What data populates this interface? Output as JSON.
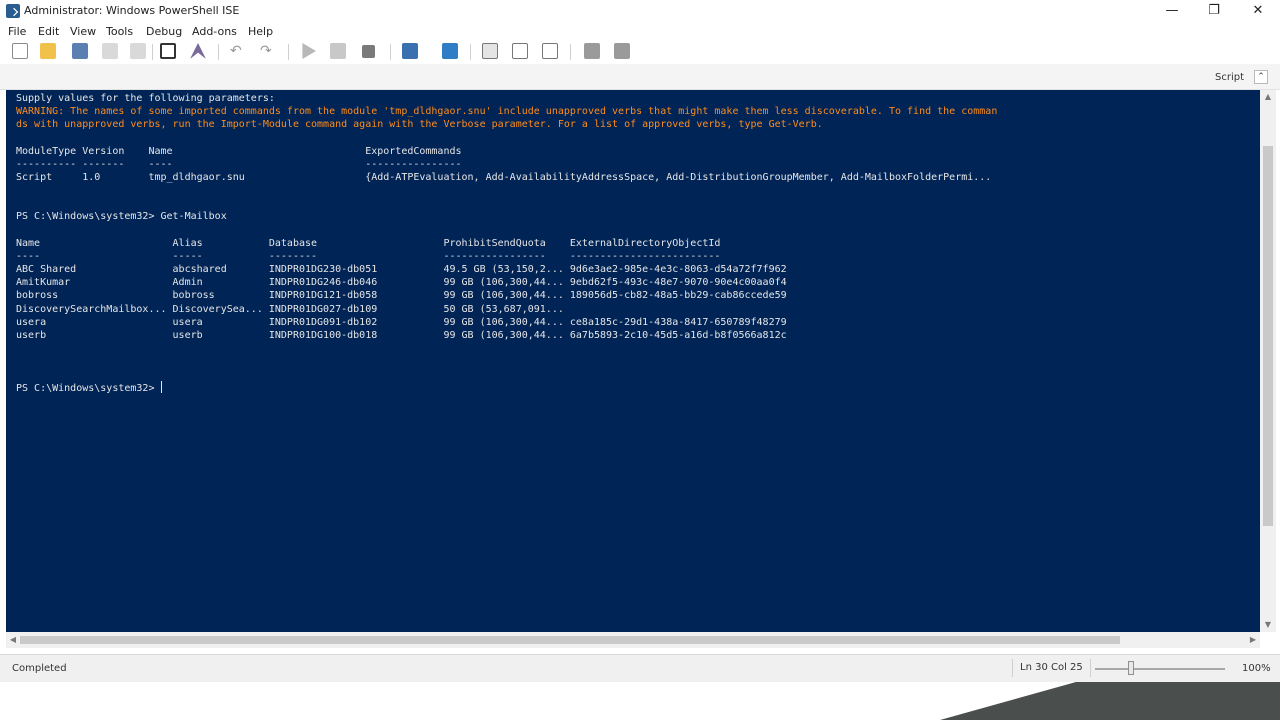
{
  "window": {
    "title": "Administrator: Windows PowerShell ISE",
    "min_glyph": "—",
    "max_glyph": "❐",
    "close_glyph": "✕"
  },
  "menu": {
    "items": [
      "File",
      "Edit",
      "View",
      "Tools",
      "Debug",
      "Add-ons",
      "Help"
    ]
  },
  "toolbar": {
    "icons": [
      "new-icon",
      "open-icon",
      "save-icon",
      "cut-icon",
      "copy-icon",
      "paste-icon",
      "clear-icon",
      "undo-icon",
      "redo-icon",
      "run-icon",
      "run-selection-icon",
      "stop-icon",
      "new-remote-tab-icon",
      "start-powershell-icon",
      "show-script-pane-top-icon",
      "show-script-pane-right-icon",
      "show-script-pane-max-icon",
      "show-command-window-icon",
      "show-command-addon-icon"
    ]
  },
  "script_bar": {
    "label": "Script",
    "chevron": "⌃"
  },
  "console": {
    "prompt_line_params": "Supply values for the following parameters:",
    "warning": "WARNING: The names of some imported commands from the module 'tmp_dldhgaor.snu' include unapproved verbs that might make them less discoverable. To find the comman\nds with unapproved verbs, run the Import-Module command again with the Verbose parameter. For a list of approved verbs, type Get-Verb.",
    "module_table": "ModuleType Version    Name                                ExportedCommands\n---------- -------    ----                                ----------------\nScript     1.0        tmp_dldhgaor.snu                    {Add-ATPEvaluation, Add-AvailabilityAddressSpace, Add-DistributionGroupMember, Add-MailboxFolderPermi...",
    "command_line": "PS C:\\Windows\\system32> Get-Mailbox",
    "mailbox_table": "Name                      Alias           Database                     ProhibitSendQuota    ExternalDirectoryObjectId\n----                      -----           --------                     -----------------    -------------------------\nABC Shared                abcshared       INDPR01DG230-db051           49.5 GB (53,150,2... 9d6e3ae2-985e-4e3c-8063-d54a72f7f962\nAmitKumar                 Admin           INDPR01DG246-db046           99 GB (106,300,44... 9ebd62f5-493c-48e7-9070-90e4c00aa0f4\nbobross                   bobross         INDPR01DG121-db058           99 GB (106,300,44... 189056d5-cb82-48a5-bb29-cab86ccede59\nDiscoverySearchMailbox... DiscoverySea... INDPR01DG027-db109           50 GB (53,687,091...\nusera                     usera           INDPR01DG091-db102           99 GB (106,300,44... ce8a185c-29d1-438a-8417-650789f48279\nuserb                     userb           INDPR01DG100-db018           99 GB (106,300,44... 6a7b5893-2c10-45d5-a16d-b8f0566a812c",
    "final_prompt": "PS C:\\Windows\\system32> "
  },
  "status": {
    "text": "Completed",
    "position": "Ln 30  Col 25",
    "zoom": "100%"
  },
  "colors": {
    "console_bg": "#012456",
    "console_fg": "#e6e6e6",
    "warning_fg": "#ff8c1a"
  }
}
